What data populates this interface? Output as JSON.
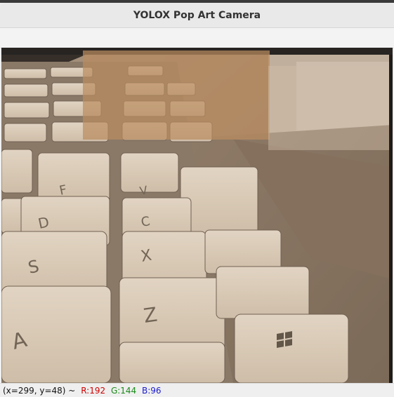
{
  "window": {
    "title": "YOLOX Pop Art Camera"
  },
  "status": {
    "coords": "(x=299, y=48) ~",
    "r": "R:192",
    "g": "G:144",
    "b": "B:96"
  },
  "colors": {
    "r_label": "#d10000",
    "g_label": "#1a8a1a",
    "b_label": "#1a1ad1",
    "overlay_tint": "#8b7762",
    "highlight_box": "#c09060",
    "keycap": "#e6d9c6"
  },
  "keys": [
    {
      "glyph": "A"
    },
    {
      "glyph": "S"
    },
    {
      "glyph": "D"
    },
    {
      "glyph": "F"
    },
    {
      "glyph": "X"
    },
    {
      "glyph": "C"
    },
    {
      "glyph": "V"
    },
    {
      "glyph": "Z"
    }
  ]
}
